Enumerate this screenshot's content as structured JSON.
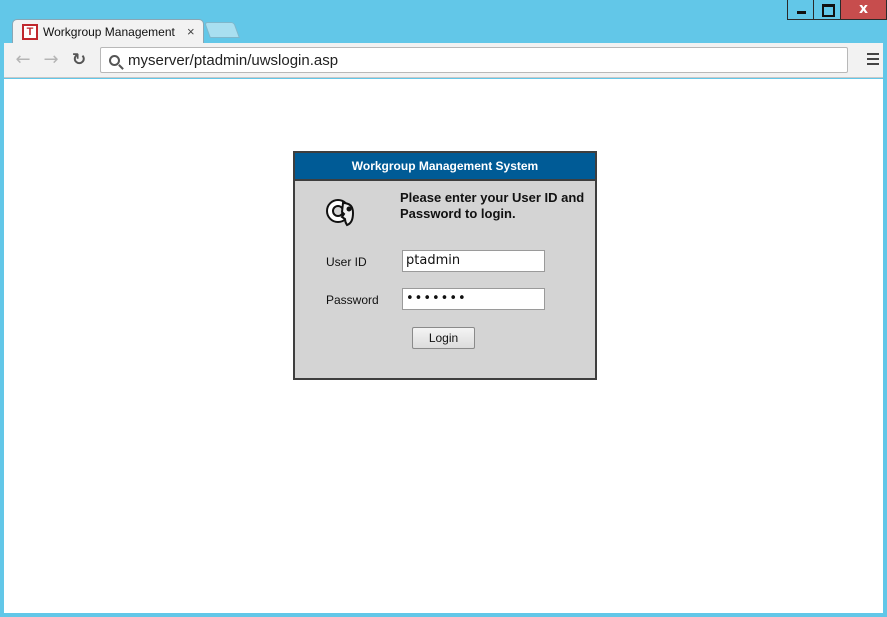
{
  "window": {
    "minimize_icon": "minimize-icon",
    "maximize_icon": "maximize-icon",
    "close_glyph": "x"
  },
  "tab": {
    "favicon_letter": "T",
    "title": "Workgroup Management",
    "close_glyph": "×"
  },
  "toolbar": {
    "back_glyph": "←",
    "forward_glyph": "→",
    "reload_glyph": "↻",
    "url": "myserver/ptadmin/uwslogin.asp"
  },
  "login": {
    "header": "Workgroup Management System",
    "prompt": "Please enter your User ID and Password to login.",
    "user_label": "User ID",
    "user_value": "ptadmin",
    "password_label": "Password",
    "password_value": "•••••••",
    "button": "Login"
  },
  "colors": {
    "header_bg": "#005b96",
    "box_bg": "#d4d4d4",
    "window_frame": "#62c7e8",
    "close_button": "#c74d4d"
  }
}
